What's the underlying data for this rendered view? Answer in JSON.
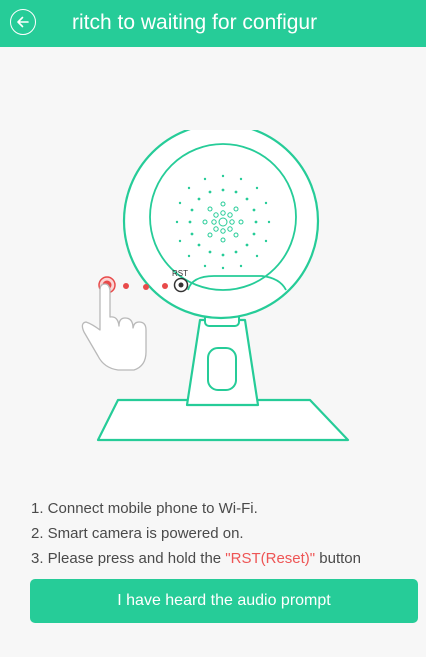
{
  "header": {
    "title": "ritch to waiting for configur",
    "back_icon": "arrow-left-circle-icon",
    "background": "#26cc98"
  },
  "illustration": {
    "rst_label": "RST",
    "icons": [
      "camera-icon",
      "hand-pointer-icon",
      "reset-hole-icon"
    ]
  },
  "instructions": {
    "step1": "1. Connect mobile phone to Wi-Fi.",
    "step2": "2. Smart camera is powered on.",
    "step3_prefix": "3. Please press and hold the ",
    "step3_highlight": "\"RST(Reset)\"",
    "step3_suffix": " button",
    "highlight_color": "#ee5555"
  },
  "primary_button": {
    "label": "I have heard the audio prompt"
  }
}
